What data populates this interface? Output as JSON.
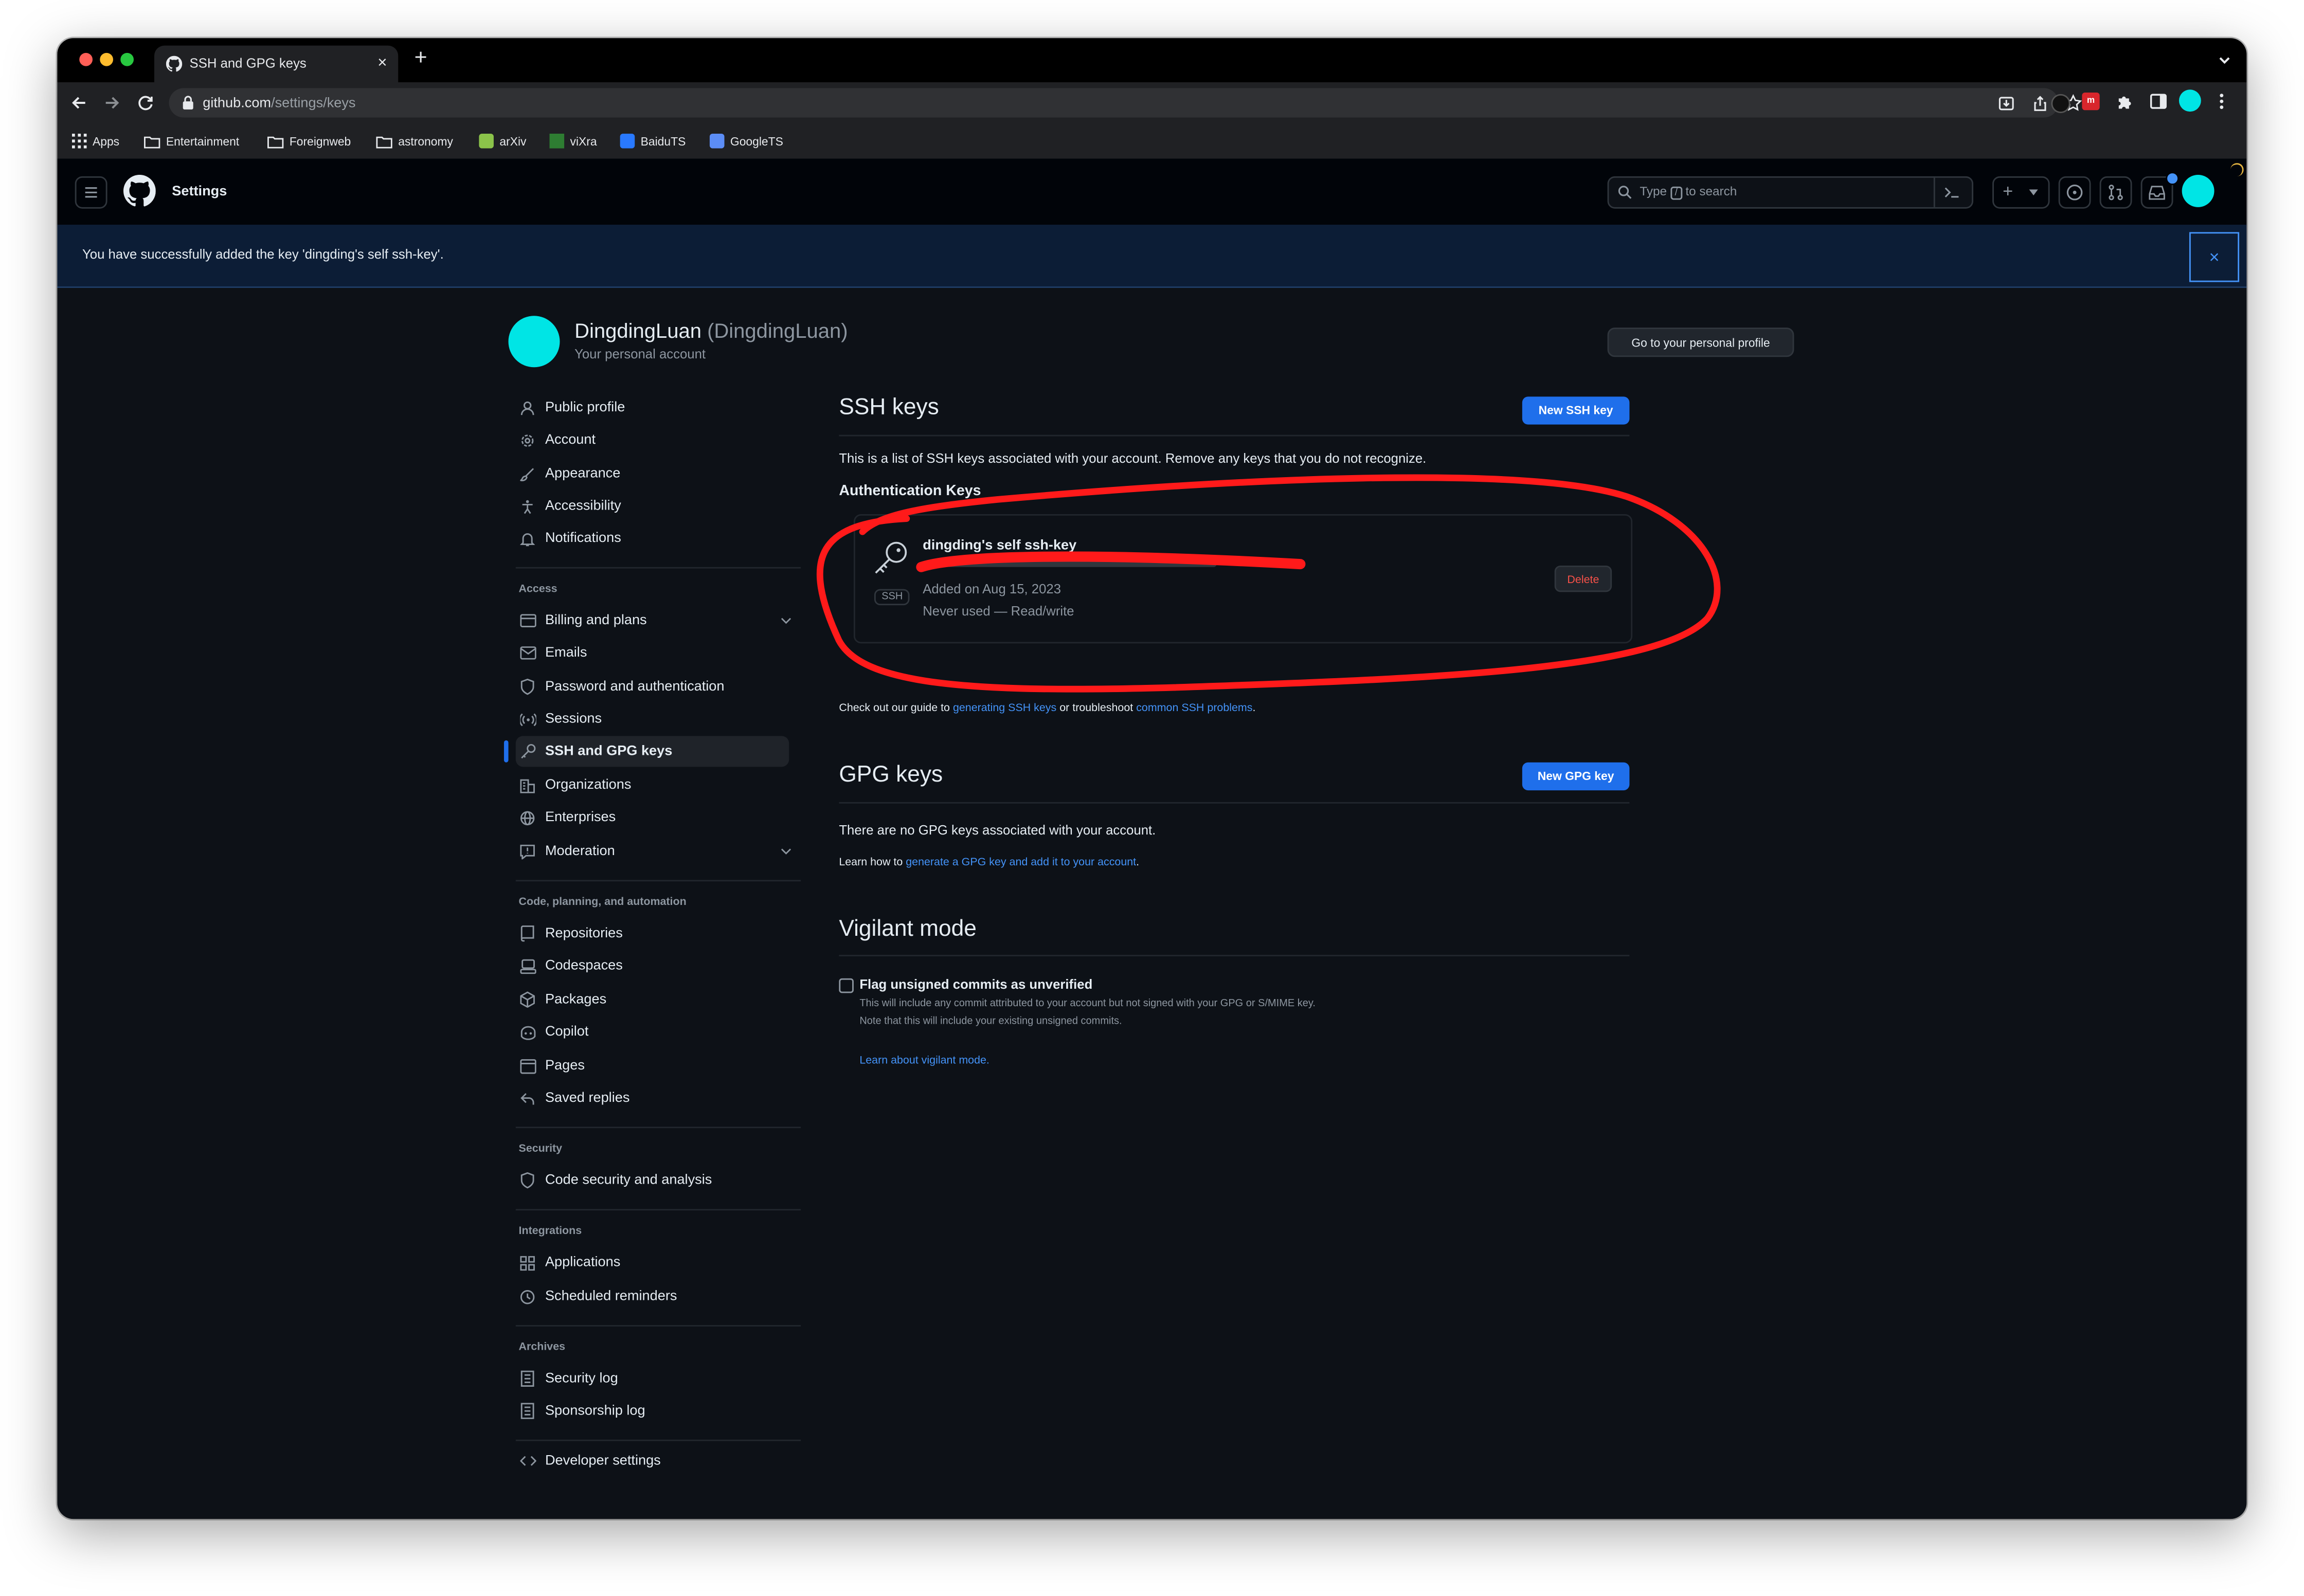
{
  "browser": {
    "tab_title": "SSH and GPG keys",
    "url_host": "github.com",
    "url_path": "/settings/keys",
    "bookmarks": [
      "Apps",
      "Entertainment",
      "Foreignweb",
      "astronomy",
      "arXiv",
      "viXra",
      "BaiduTS",
      "GoogleTS"
    ]
  },
  "header": {
    "title": "Settings",
    "search_placeholder": "Type",
    "search_key": "/",
    "search_suffix": "to search"
  },
  "banner": {
    "message": "You have successfully added the key 'dingding's self ssh-key'.",
    "close": "×"
  },
  "profile": {
    "name": "DingdingLuan",
    "handle": "(DingdingLuan)",
    "subtitle": "Your personal account",
    "go_profile_button": "Go to your personal profile"
  },
  "sidebar": {
    "top_items": [
      "Public profile",
      "Account",
      "Appearance",
      "Accessibility",
      "Notifications"
    ],
    "access_heading": "Access",
    "access_items": [
      "Billing and plans",
      "Emails",
      "Password and authentication",
      "Sessions",
      "SSH and GPG keys",
      "Organizations",
      "Enterprises",
      "Moderation"
    ],
    "code_heading": "Code, planning, and automation",
    "code_items": [
      "Repositories",
      "Codespaces",
      "Packages",
      "Copilot",
      "Pages",
      "Saved replies"
    ],
    "security_heading": "Security",
    "security_items": [
      "Code security and analysis"
    ],
    "integrations_heading": "Integrations",
    "integrations_items": [
      "Applications",
      "Scheduled reminders"
    ],
    "archives_heading": "Archives",
    "archives_items": [
      "Security log",
      "Sponsorship log"
    ],
    "developer_item": "Developer settings"
  },
  "ssh": {
    "title": "SSH keys",
    "new_button": "New SSH key",
    "description": "This is a list of SSH keys associated with your account. Remove any keys that you do not recognize.",
    "auth_heading": "Authentication Keys",
    "key_title": "dingding's self ssh-key",
    "key_type_badge": "SSH",
    "added": "Added on Aug 15, 2023",
    "usage": "Never used — Read/write",
    "delete_button": "Delete",
    "guide_prefix": "Check out our guide to",
    "guide_link": "generating SSH keys",
    "guide_middle": "or troubleshoot",
    "guide_link2": "common SSH problems",
    "guide_suffix": "."
  },
  "gpg": {
    "title": "GPG keys",
    "new_button": "New GPG key",
    "empty": "There are no GPG keys associated with your account.",
    "learn_prefix": "Learn how to",
    "learn_link": "generate a GPG key and add it to your account",
    "learn_suffix": "."
  },
  "vigilant": {
    "title": "Vigilant mode",
    "checkbox_label": "Flag unsigned commits as unverified",
    "help1": "This will include any commit attributed to your account but not signed with your GPG or S/MIME key.",
    "help2": "Note that this will include your existing unsigned commits.",
    "learn_link": "Learn about vigilant mode."
  },
  "colors": {
    "accent": "#1f6feb",
    "link": "#4493f8",
    "avatar": "#00e5e5",
    "annotation": "#ff1a1a",
    "danger": "#f85149"
  }
}
